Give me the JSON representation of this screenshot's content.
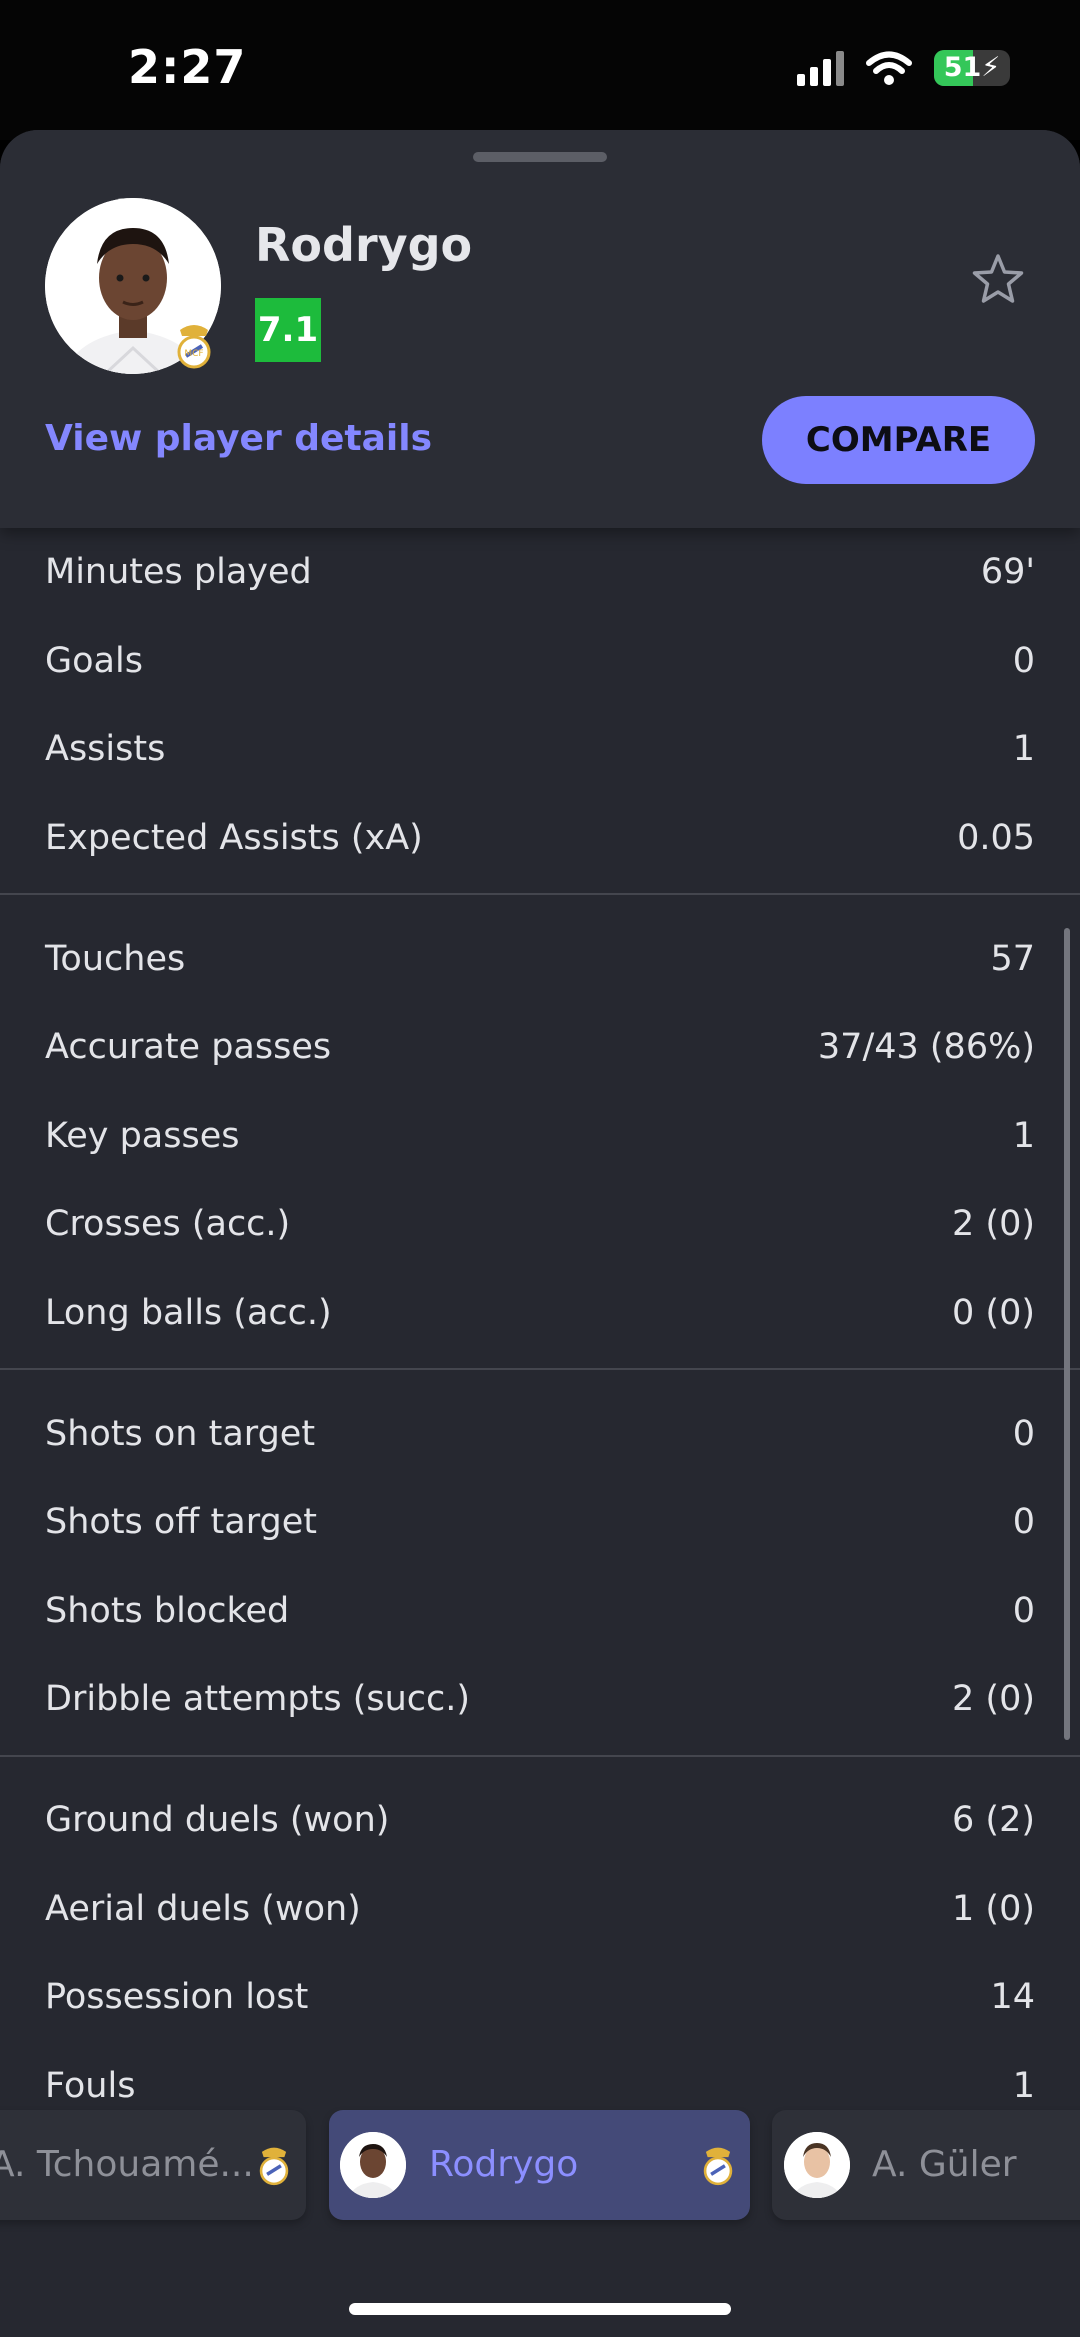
{
  "status_bar": {
    "time": "2:27",
    "battery": "51"
  },
  "player": {
    "name": "Rodrygo",
    "rating": "7.1"
  },
  "header": {
    "view_details": "View player details",
    "compare": "COMPARE"
  },
  "stats": {
    "group1": [
      {
        "label": "Minutes played",
        "value": "69'"
      },
      {
        "label": "Goals",
        "value": "0"
      },
      {
        "label": "Assists",
        "value": "1"
      },
      {
        "label": "Expected Assists (xA)",
        "value": "0.05"
      }
    ],
    "group2": [
      {
        "label": "Touches",
        "value": "57"
      },
      {
        "label": "Accurate passes",
        "value": "37/43 (86%)"
      },
      {
        "label": "Key passes",
        "value": "1"
      },
      {
        "label": "Crosses (acc.)",
        "value": "2 (0)"
      },
      {
        "label": "Long balls (acc.)",
        "value": "0 (0)"
      }
    ],
    "group3": [
      {
        "label": "Shots on target",
        "value": "0"
      },
      {
        "label": "Shots off target",
        "value": "0"
      },
      {
        "label": "Shots blocked",
        "value": "0"
      },
      {
        "label": "Dribble attempts (succ.)",
        "value": "2 (0)"
      }
    ],
    "group4": [
      {
        "label": "Ground duels (won)",
        "value": "6 (2)"
      },
      {
        "label": "Aerial duels (won)",
        "value": "1 (0)"
      },
      {
        "label": "Possession lost",
        "value": "14"
      },
      {
        "label": "Fouls",
        "value": "1"
      }
    ]
  },
  "player_tabs": [
    {
      "name": "A. Tchouamé..."
    },
    {
      "name": "Rodrygo"
    },
    {
      "name": "A. Güler"
    }
  ],
  "colors": {
    "accent": "#7c80ff",
    "rating_bg": "#1dbb3c",
    "sheet_bg": "#262830",
    "selected_chip": "#444a78"
  }
}
